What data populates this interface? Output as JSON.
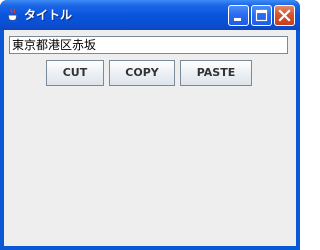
{
  "window": {
    "title": "タイトル"
  },
  "titlebar": {
    "app_icon": "java-coffee-cup-icon",
    "controls": {
      "minimize_icon": "minimize-icon",
      "maximize_icon": "maximize-icon",
      "close_icon": "close-icon"
    }
  },
  "main": {
    "text_field_value": "東京都港区赤坂",
    "buttons": {
      "cut_label": "CUT",
      "copy_label": "COPY",
      "paste_label": "PASTE"
    }
  },
  "colors": {
    "titlebar_blue": "#0a58d6",
    "client_bg": "#eeeeee",
    "close_red": "#d8532f"
  }
}
